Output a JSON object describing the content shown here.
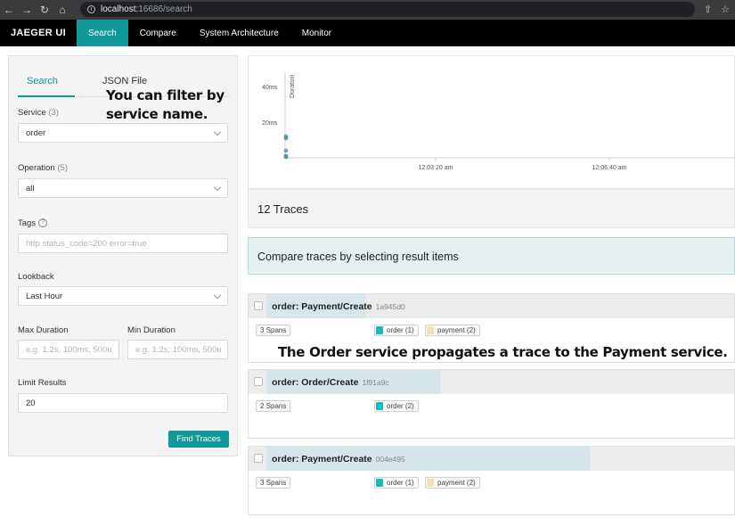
{
  "browser": {
    "url_host": "localhost:",
    "url_port_path": "16686/search"
  },
  "topnav": {
    "brand": "JAEGER UI",
    "items": [
      "Search",
      "Compare",
      "System Architecture",
      "Monitor"
    ]
  },
  "search_panel": {
    "tabs": [
      "Search",
      "JSON File"
    ],
    "service": {
      "label": "Service",
      "count": "(3)",
      "value": "order"
    },
    "operation": {
      "label": "Operation",
      "count": "(5)",
      "value": "all"
    },
    "tags": {
      "label": "Tags",
      "placeholder": "http.status_code=200 error=true"
    },
    "lookback": {
      "label": "Lookback",
      "value": "Last Hour"
    },
    "max_duration": {
      "label": "Max Duration",
      "placeholder": "e.g. 1.2s, 100ms, 500u"
    },
    "min_duration": {
      "label": "Min Duration",
      "placeholder": "e.g. 1.2s, 100ms, 500u"
    },
    "limit": {
      "label": "Limit Results",
      "value": "20"
    },
    "find_button": "Find Traces"
  },
  "chart_data": {
    "type": "scatter",
    "ylabel": "Duration",
    "y_ticks": [
      "40ms",
      "20ms"
    ],
    "x_ticks": [
      "12:03:20 am",
      "12:06:40 am"
    ],
    "ylim_ms": [
      0,
      48
    ],
    "points": [
      {
        "x": 0,
        "y": 12
      },
      {
        "x": 0,
        "y": 11
      },
      {
        "x": 0,
        "y": 4
      },
      {
        "x": 0,
        "y": 1
      },
      {
        "x": 0,
        "y": 0.5
      }
    ]
  },
  "results": {
    "count": "12 Traces",
    "compare_text": "Compare traces by selecting result items",
    "traces": [
      {
        "title": "order: Payment/Create",
        "id": "1a945d0",
        "spans": "3 Spans",
        "bar_fraction": 0.12,
        "services": [
          {
            "name": "order (1)",
            "color": "#17b8be"
          },
          {
            "name": "payment (2)",
            "color": "#f8dcb4"
          }
        ]
      },
      {
        "title": "order: Order/Create",
        "id": "1f91a9c",
        "spans": "2 Spans",
        "bar_fraction": 0.28,
        "services": [
          {
            "name": "order (2)",
            "color": "#17b8be"
          }
        ]
      },
      {
        "title": "order: Payment/Create",
        "id": "004e495",
        "spans": "3 Spans",
        "bar_fraction": 0.6,
        "services": [
          {
            "name": "order (1)",
            "color": "#17b8be"
          },
          {
            "name": "payment (2)",
            "color": "#f8dcb4"
          }
        ]
      }
    ]
  },
  "annotations": {
    "note_1": "You can filter by service name.",
    "note_2": "The Order service propagates a trace to the Payment service."
  }
}
